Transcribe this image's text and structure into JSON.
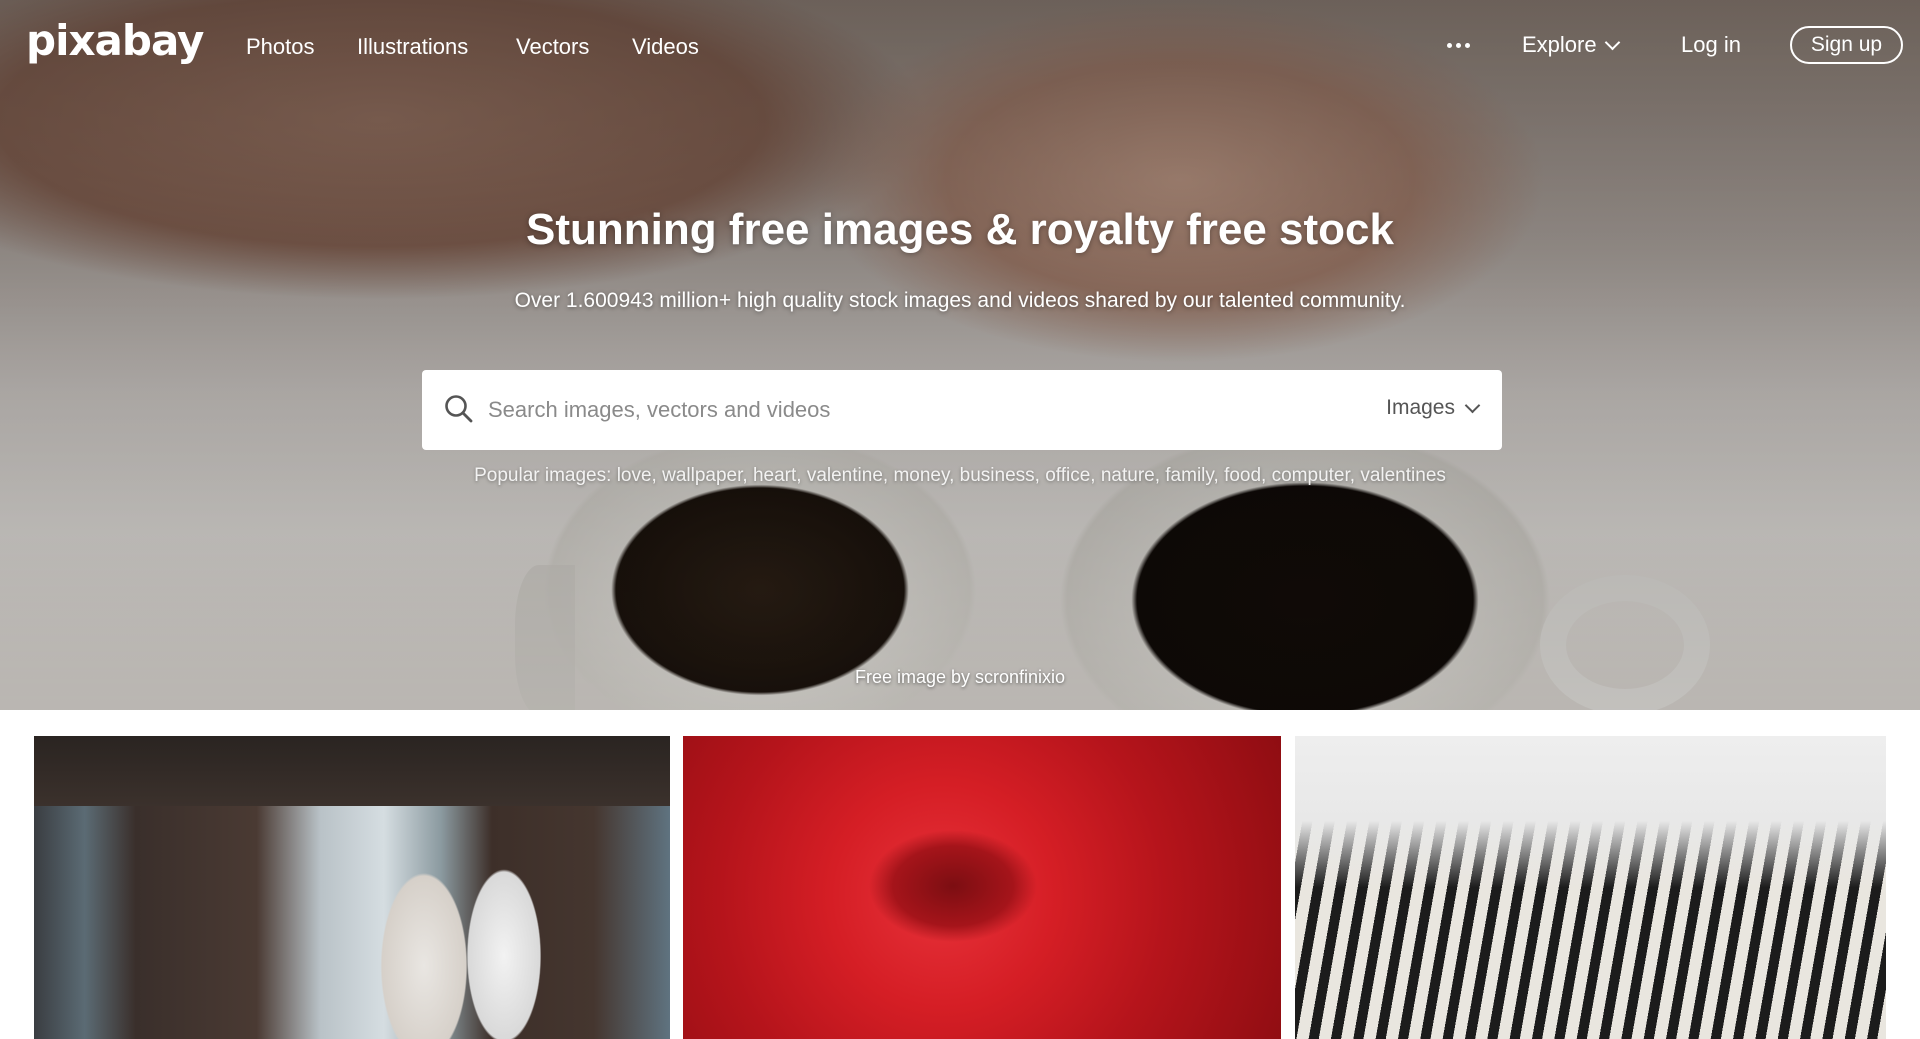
{
  "header": {
    "logo": "pixabay",
    "nav": [
      "Photos",
      "Illustrations",
      "Vectors",
      "Videos"
    ],
    "explore_label": "Explore",
    "login_label": "Log in",
    "signup_label": "Sign up"
  },
  "hero": {
    "headline": "Stunning free images & royalty free stock",
    "subline": "Over 1.600943 million+ high quality stock images and videos shared by our talented community.",
    "search_placeholder": "Search images, vectors and videos",
    "search_type": "Images",
    "popular_prefix": "Popular images:",
    "popular_tags": [
      "love",
      "wallpaper",
      "heart",
      "valentine",
      "money",
      "business",
      "office",
      "nature",
      "family",
      "food",
      "computer",
      "valentines"
    ],
    "credit": "Free image by scronfinixio"
  },
  "gallery": {
    "items": [
      "couple",
      "red rose",
      "zebras"
    ]
  },
  "colors": {
    "text_on_hero": "#ffffff",
    "search_bg": "#ffffff",
    "placeholder": "#8a8a8a"
  }
}
